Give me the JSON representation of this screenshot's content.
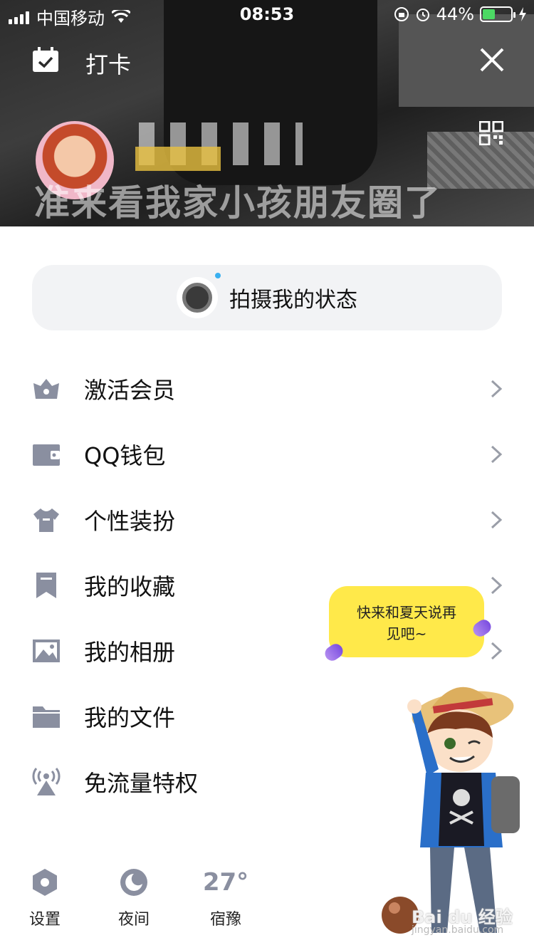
{
  "status_bar": {
    "carrier": "中国移动",
    "time": "08:53",
    "battery": "44%",
    "battery_level": 0.44
  },
  "header": {
    "checkin_label": "打卡",
    "banner_text": "准来看我家小孩朋友圈了"
  },
  "status_capture": {
    "label": "拍摄我的状态"
  },
  "menu": {
    "items": [
      {
        "label": "激活会员",
        "icon": "crown-icon"
      },
      {
        "label": "QQ钱包",
        "icon": "wallet-icon"
      },
      {
        "label": "个性装扮",
        "icon": "tshirt-icon"
      },
      {
        "label": "我的收藏",
        "icon": "bookmark-icon"
      },
      {
        "label": "我的相册",
        "icon": "image-icon"
      },
      {
        "label": "我的文件",
        "icon": "folder-icon"
      },
      {
        "label": "免流量特权",
        "icon": "broadcast-icon"
      }
    ]
  },
  "footer": {
    "settings_label": "设置",
    "night_label": "夜间",
    "temperature": "27°",
    "city": "宿豫"
  },
  "mascot": {
    "bubble_line1": "快来和夏天说再",
    "bubble_line2": "见吧~"
  },
  "watermark": {
    "brand": "Bai du 经验",
    "site": "jingyan.baidu.com"
  },
  "colors": {
    "icon_gray": "#8a8fa0",
    "capture_bg": "#f2f3f5",
    "bubble_yellow": "#ffe94a",
    "battery_green": "#4cd964"
  }
}
